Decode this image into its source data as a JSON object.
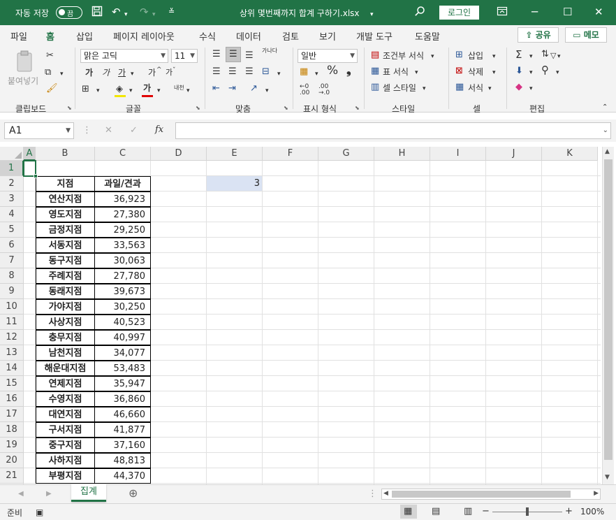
{
  "titlebar": {
    "autosave_label": "자동 저장",
    "autosave_state": "끔",
    "doc_title": "상위 몇번째까지 합계 구하기.xlsx",
    "login_label": "로그인"
  },
  "menu": {
    "tabs": [
      "파일",
      "홈",
      "삽입",
      "페이지 레이아웃",
      "수식",
      "데이터",
      "검토",
      "보기",
      "개발 도구",
      "도움말"
    ],
    "active": "홈",
    "share_label": "공유",
    "comment_label": "메모"
  },
  "ribbon": {
    "clipboard": {
      "paste_label": "붙여넣기",
      "group_label": "클립보드"
    },
    "font": {
      "font_name": "맑은 고딕",
      "font_size": "11",
      "group_label": "글꼴",
      "bold": "가",
      "italic": "가",
      "underline": "가",
      "grow": "가",
      "shrink": "가",
      "font_color": "가",
      "phonetic": "내천"
    },
    "align": {
      "group_label": "맞춤",
      "wrap": "가나다"
    },
    "number": {
      "format": "일반",
      "group_label": "표시 형식"
    },
    "styles": {
      "cond_format": "조건부 서식",
      "table_format": "표 서식",
      "cell_styles": "셀 스타일",
      "group_label": "스타일"
    },
    "cells": {
      "insert": "삽입",
      "delete": "삭제",
      "format": "서식",
      "group_label": "셀"
    },
    "editing": {
      "group_label": "편집"
    }
  },
  "formula_bar": {
    "name_box": "A1",
    "fx": "fx",
    "formula": ""
  },
  "columns": [
    "A",
    "B",
    "C",
    "D",
    "E",
    "F",
    "G",
    "H",
    "I",
    "J",
    "K"
  ],
  "rows": [
    "1",
    "2",
    "3",
    "4",
    "5",
    "6",
    "7",
    "8",
    "9",
    "10",
    "11",
    "12",
    "13",
    "14",
    "15",
    "16",
    "17",
    "18",
    "19",
    "20",
    "21"
  ],
  "table": {
    "headers": [
      "지점",
      "과일/견과"
    ],
    "rows": [
      [
        "연산지점",
        "36,923"
      ],
      [
        "영도지점",
        "27,380"
      ],
      [
        "금정지점",
        "29,250"
      ],
      [
        "서동지점",
        "33,563"
      ],
      [
        "동구지점",
        "30,063"
      ],
      [
        "주례지점",
        "27,780"
      ],
      [
        "동래지점",
        "39,673"
      ],
      [
        "가야지점",
        "30,250"
      ],
      [
        "사상지점",
        "40,523"
      ],
      [
        "충무지점",
        "40,997"
      ],
      [
        "남천지점",
        "34,077"
      ],
      [
        "해운대지점",
        "53,483"
      ],
      [
        "연제지점",
        "35,947"
      ],
      [
        "수영지점",
        "36,860"
      ],
      [
        "대연지점",
        "46,660"
      ],
      [
        "구서지점",
        "41,877"
      ],
      [
        "중구지점",
        "37,160"
      ],
      [
        "사하지점",
        "48,813"
      ],
      [
        "부평지점",
        "44,370"
      ]
    ]
  },
  "e2_value": "3",
  "sheets": {
    "active": "집계"
  },
  "status": {
    "ready": "준비",
    "zoom": "100%"
  },
  "colors": {
    "accent": "#217346",
    "selection": "#dae3f3"
  }
}
